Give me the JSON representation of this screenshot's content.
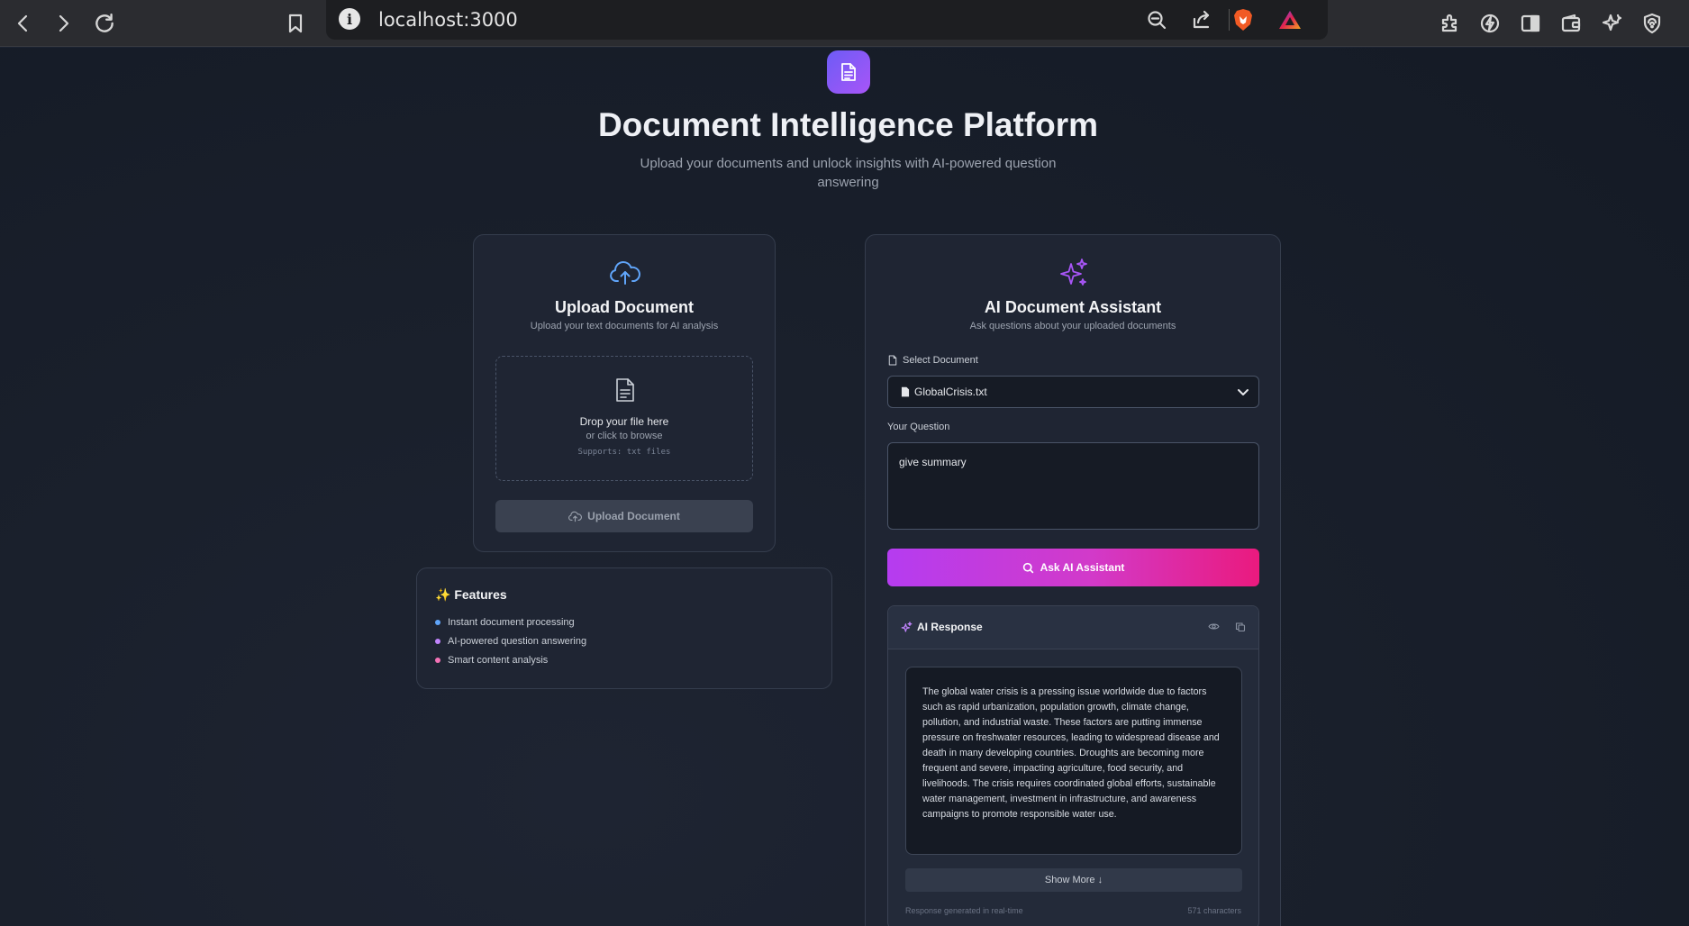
{
  "browser": {
    "url": "localhost:3000"
  },
  "header": {
    "title": "Document Intelligence Platform",
    "subtitle": "Upload your documents and unlock insights with AI-powered question answering"
  },
  "upload": {
    "title": "Upload Document",
    "subtitle": "Upload your text documents for AI analysis",
    "drop_main": "Drop your file here",
    "drop_sub": "or click to browse",
    "drop_note": "Supports: txt files",
    "button_label": "Upload Document"
  },
  "features": {
    "title": "✨ Features",
    "items": [
      {
        "label": "Instant document processing",
        "color": "#60a5fa"
      },
      {
        "label": "AI-powered question answering",
        "color": "#c084fc"
      },
      {
        "label": "Smart content analysis",
        "color": "#f472b6"
      }
    ]
  },
  "assistant": {
    "title": "AI Document Assistant",
    "subtitle": "Ask questions about your uploaded documents",
    "select_label": "Select Document",
    "selected_document": "GlobalCrisis.txt",
    "question_label": "Your Question",
    "question_value": "give summary",
    "ask_label": "Ask AI Assistant"
  },
  "response": {
    "title": "AI Response",
    "text": "The global water crisis is a pressing issue worldwide due to factors such as rapid urbanization, population growth, climate change, pollution, and industrial waste. These factors are putting immense pressure on freshwater resources, leading to widespread disease and death in many developing countries. Droughts are becoming more frequent and severe, impacting agriculture, food security, and livelihoods. The crisis requires coordinated global efforts, sustainable water management, investment in infrastructure, and awareness campaigns to promote responsible water use.",
    "show_more": "Show More ↓",
    "footer_left": "Response generated in real-time",
    "footer_right": "571 characters"
  },
  "colors": {
    "accent_purple": "#a855f7",
    "accent_pink": "#ec4899",
    "icon_blue": "#60a5fa"
  }
}
